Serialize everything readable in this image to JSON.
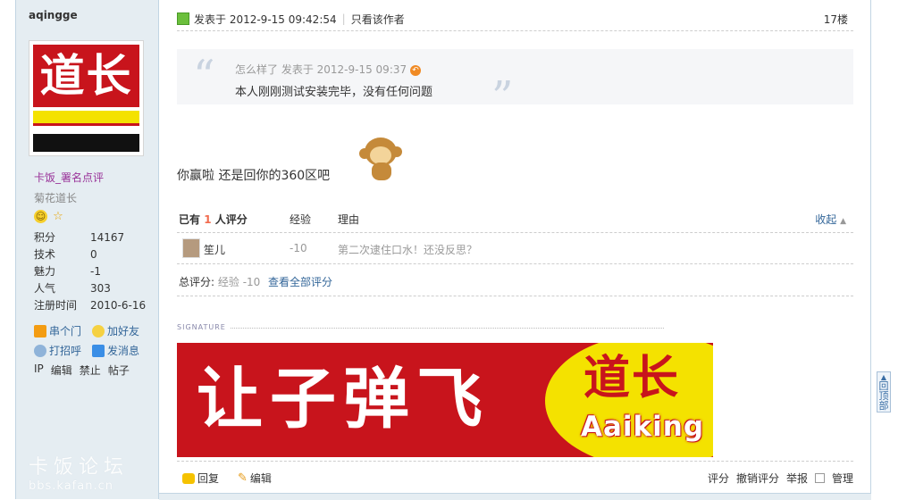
{
  "author": {
    "name": "aqingge",
    "group_link": "卡饭_署名点评",
    "rank_title": "菊花道长",
    "avatar_text": "道长",
    "stats": [
      {
        "label": "积分",
        "value": "14167"
      },
      {
        "label": "技术",
        "value": "0"
      },
      {
        "label": "魅力",
        "value": "-1"
      },
      {
        "label": "人气",
        "value": "303"
      },
      {
        "label": "注册时间",
        "value": "2010-6-16"
      }
    ],
    "actions": {
      "visit": "串个门",
      "add_friend": "加好友",
      "greet": "打招呼",
      "message": "发消息"
    },
    "admin": {
      "ip": "IP",
      "edit": "编辑",
      "ban": "禁止",
      "posts": "帖子"
    }
  },
  "watermark": {
    "title": "卡饭论坛",
    "url": "bbs.kafan.cn"
  },
  "post": {
    "posted_at": "发表于 2012-9-15 09:42:54",
    "only_author": "只看该作者",
    "floor": "17楼",
    "quote": {
      "meta": "怎么样了 发表于 2012-9-15 09:37",
      "text": "本人刚刚测试安装完毕，没有任何问题"
    },
    "reply": "你赢啦  还是回你的360区吧"
  },
  "rating": {
    "title_prefix": "已有",
    "count": "1",
    "title_suffix": "人评分",
    "col_exp": "经验",
    "col_reason": "理由",
    "collapse": "收起",
    "rows": [
      {
        "user": "笙儿",
        "score": "-10",
        "reason": "第二次逮住口水！还没反思？"
      }
    ],
    "total_label": "总评分:",
    "total_value": "经验 -10",
    "view_all": "查看全部评分"
  },
  "signature": {
    "label": "SIGNATURE",
    "banner_text": "让子弹飞",
    "banner_brand": "道长",
    "banner_brand_en": "Aaiking"
  },
  "footer": {
    "reply": "回复",
    "edit": "编辑",
    "rate": "评分",
    "undo_rate": "撤销评分",
    "report": "举报",
    "manage": "管理"
  },
  "back_to_top": "回顶部",
  "colors": {
    "accent_link": "#336699",
    "sidebar_bg": "#e5edf2",
    "brand_red": "#c8141c",
    "brand_yellow": "#f4e200"
  }
}
